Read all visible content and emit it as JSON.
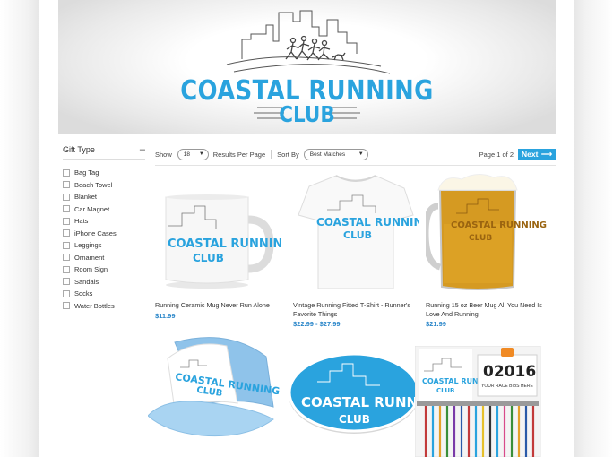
{
  "brand": {
    "line1": "COASTAL RUNNING",
    "line2": "CLUB",
    "accent_color": "#2aa3de"
  },
  "sidebar": {
    "title": "Gift Type",
    "collapse_icon": "minus-icon",
    "items": [
      {
        "label": "Bag Tag"
      },
      {
        "label": "Beach Towel"
      },
      {
        "label": "Blanket"
      },
      {
        "label": "Car Magnet"
      },
      {
        "label": "Hats"
      },
      {
        "label": "iPhone Cases"
      },
      {
        "label": "Leggings"
      },
      {
        "label": "Ornament"
      },
      {
        "label": "Room Sign"
      },
      {
        "label": "Sandals"
      },
      {
        "label": "Socks"
      },
      {
        "label": "Water Bottles"
      }
    ]
  },
  "toolbar": {
    "show_label": "Show",
    "show_value": "18",
    "results_label": "Results Per Page",
    "sort_label": "Sort By",
    "sort_value": "Best Matches",
    "page_info": "Page 1 of 2",
    "next_label": "Next",
    "next_icon": "arrow-right-icon"
  },
  "products": [
    {
      "name": "Running Ceramic Mug Never Run Alone",
      "price": "$11.99",
      "icon": "mug-icon"
    },
    {
      "name": "Vintage Running Fitted T-Shirt - Runner's Favorite Things",
      "price": "$22.99 - $27.99",
      "icon": "tshirt-icon"
    },
    {
      "name": "Running 15 oz Beer Mug All You Need Is Love And Running",
      "price": "$21.99",
      "icon": "beer-mug-icon"
    },
    {
      "name": "",
      "price": "",
      "icon": "trucker-hat-icon"
    },
    {
      "name": "",
      "price": "",
      "icon": "car-magnet-icon"
    },
    {
      "name": "",
      "price": "",
      "icon": "medal-hanger-icon"
    }
  ],
  "thumb_text": {
    "logo_line1": "COASTAL RUNNING",
    "logo_line2": "CLUB",
    "bib_number": "02016",
    "bib_caption": "YOUR RACE BIBS HERE"
  }
}
